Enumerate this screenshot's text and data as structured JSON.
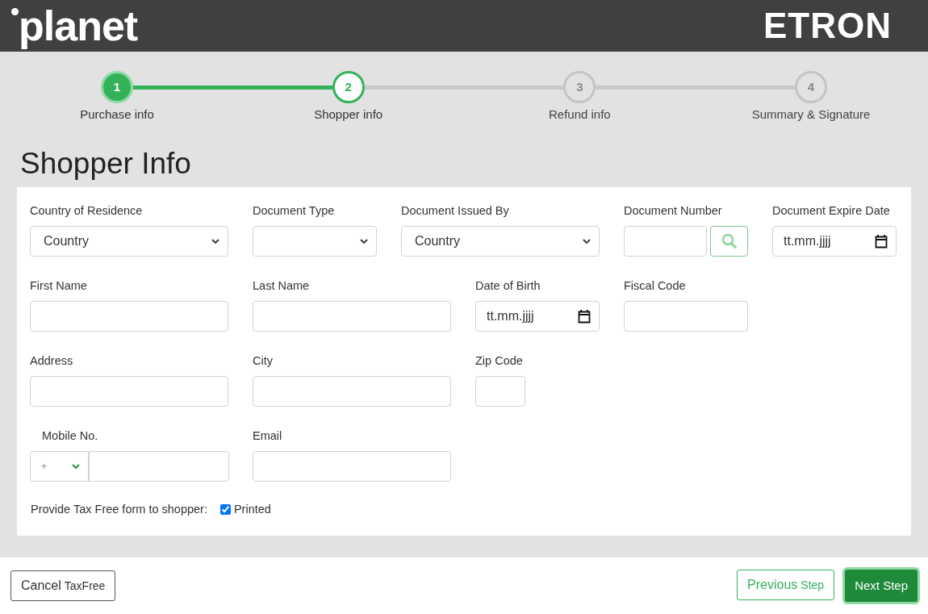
{
  "header": {
    "logo_left": "planet",
    "logo_right": "ETRON"
  },
  "steps": [
    {
      "number": "1",
      "label": "Purchase info",
      "completed": true,
      "selected": false
    },
    {
      "number": "2",
      "label": "Shopper info",
      "completed": false,
      "selected": true
    },
    {
      "number": "3",
      "label": "Refund info",
      "completed": false,
      "selected": false
    },
    {
      "number": "4",
      "label": "Summary & Signature",
      "completed": false,
      "selected": false
    }
  ],
  "title": "Shopper Info",
  "form_rows": [
    [
      {
        "kind": "select",
        "label": "Country of Residence",
        "value": "Country"
      },
      {
        "kind": "select",
        "label": "Document Type"
      },
      {
        "kind": "select",
        "label": "Document Issued By",
        "value": "Country"
      },
      {
        "kind": "search",
        "label": "Document Number"
      },
      {
        "kind": "date",
        "label": "Document Expire Date",
        "hint": "tt.mm.jjjj"
      }
    ],
    [
      {
        "kind": "text",
        "label": "First Name"
      },
      {
        "kind": "text",
        "label": "Last Name"
      },
      {
        "kind": "date",
        "label": "Date of Birth",
        "hint": "tt.mm.jjjj"
      },
      {
        "kind": "text",
        "label": "Fiscal Code"
      }
    ],
    [
      {
        "kind": "text",
        "label": "Address"
      },
      {
        "kind": "text",
        "label": "City"
      },
      {
        "kind": "text",
        "label": "Zip Code"
      }
    ],
    [
      {
        "kind": "phone",
        "label": "Mobile No.",
        "prefix": "+"
      },
      {
        "kind": "text",
        "label": "Email"
      }
    ]
  ],
  "tax_free_form": {
    "label": "Provide Tax Free form to shopper:",
    "option": "Printed",
    "checked": true
  },
  "footer": {
    "cancel": {
      "main": "Cancel",
      "sub": "TaxFree"
    },
    "previous": {
      "main": "Previous",
      "sub": "Step"
    },
    "next": "Next Step"
  }
}
